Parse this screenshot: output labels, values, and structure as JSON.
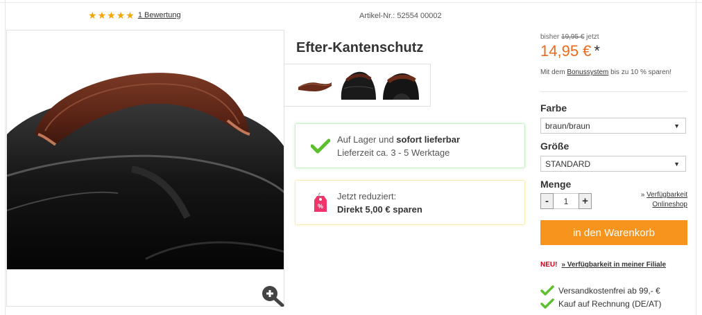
{
  "rating": {
    "stars": 5,
    "link_label": "1 Bewertung"
  },
  "article_number": "Artikel-Nr.: 52554 00002",
  "product": {
    "title": "Efter-Kantenschutz"
  },
  "thumbnails": [
    "thumbnail-1",
    "thumbnail-2",
    "thumbnail-3"
  ],
  "stock": {
    "line1_prefix": "Auf Lager und ",
    "line1_bold": "sofort lieferbar",
    "line2": "Lieferzeit ca. 3 - 5 Werktage"
  },
  "promo": {
    "line1": "Jetzt reduziert:",
    "line2": "Direkt 5,00 € sparen"
  },
  "pricing": {
    "old_prefix": "bisher ",
    "old_price": "19,95 €",
    "old_suffix": " jetzt",
    "price": "14,95 €",
    "asterisk": "*",
    "bonus_prefix": "Mit dem ",
    "bonus_link": "Bonussystem",
    "bonus_suffix": " bis zu 10 % sparen!"
  },
  "options": {
    "color_label": "Farbe",
    "color_value": "braun/braun",
    "size_label": "Größe",
    "size_value": "STANDARD",
    "quantity_label": "Menge",
    "quantity_value": "1",
    "minus": "-",
    "plus": "+"
  },
  "availability_online": {
    "prefix": "» ",
    "line1": "Verfügbarkeit",
    "line2": "Onlineshop"
  },
  "cart_button": "in den Warenkorb",
  "store_availability": {
    "badge": "NEU!",
    "link": "» Verfügbarkeit in meiner Filiale"
  },
  "benefits": [
    "Versandkostenfrei ab 99,- €",
    "Kauf auf Rechnung (DE/AT)"
  ],
  "colors": {
    "accent_orange": "#f7941d",
    "price_orange": "#ec6a1c",
    "star": "#f5a500",
    "check_green": "#5cc02e",
    "new_red": "#c4001a"
  }
}
